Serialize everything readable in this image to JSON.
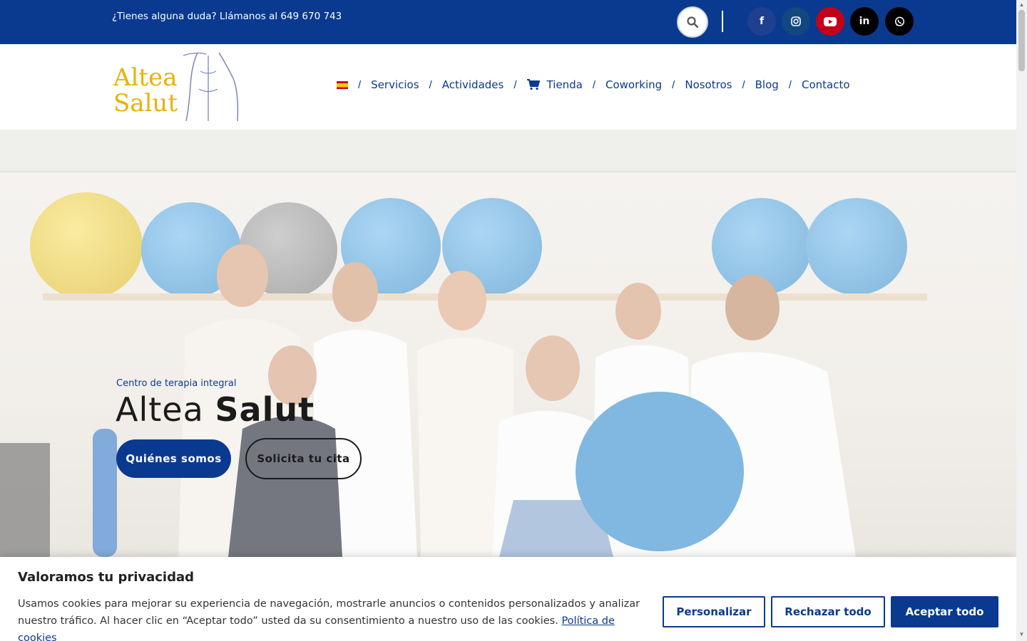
{
  "topbar": {
    "phone_text": "¿Tienes alguna duda? Llámanos al 649 670 743",
    "search_icon": "search-icon",
    "socials": [
      {
        "name": "facebook",
        "glyph": "f",
        "color": "#1f3f8f"
      },
      {
        "name": "instagram",
        "glyph": "◎",
        "color": "#12477f"
      },
      {
        "name": "youtube",
        "glyph": "▶",
        "color": "#c40018"
      },
      {
        "name": "linkedin",
        "glyph": "in",
        "color": "#000000"
      },
      {
        "name": "whatsapp",
        "glyph": "✆",
        "color": "#000000"
      }
    ]
  },
  "header": {
    "logo_word1": "Altea",
    "logo_word2": "Salut",
    "nav": [
      {
        "label": "Servicios"
      },
      {
        "label": "Actividades"
      },
      {
        "label": "Tienda",
        "icon": "cart-icon"
      },
      {
        "label": "Coworking"
      },
      {
        "label": "Nosotros"
      },
      {
        "label": "Blog"
      },
      {
        "label": "Contacto"
      }
    ],
    "separator": "/"
  },
  "hero": {
    "subtitle": "Centro de terapia integral",
    "title_light": "Altea",
    "title_bold": "Salut",
    "primary_button": "Quiénes somos",
    "secondary_button": "Solicita tu cita"
  },
  "cookie": {
    "title": "Valoramos tu privacidad",
    "text": "Usamos cookies para mejorar su experiencia de navegación, mostrarle anuncios o contenidos personalizados y analizar nuestro tráfico. Al hacer clic en “Aceptar todo” usted da su consentimiento a nuestro uso de las cookies.",
    "policy_link": "Política de cookies",
    "customize_button": "Personalizar",
    "reject_button": "Rechazar todo",
    "accept_button": "Aceptar todo"
  },
  "colors": {
    "brand_blue": "#0a3a8f",
    "logo_gold": "#e8b200"
  }
}
